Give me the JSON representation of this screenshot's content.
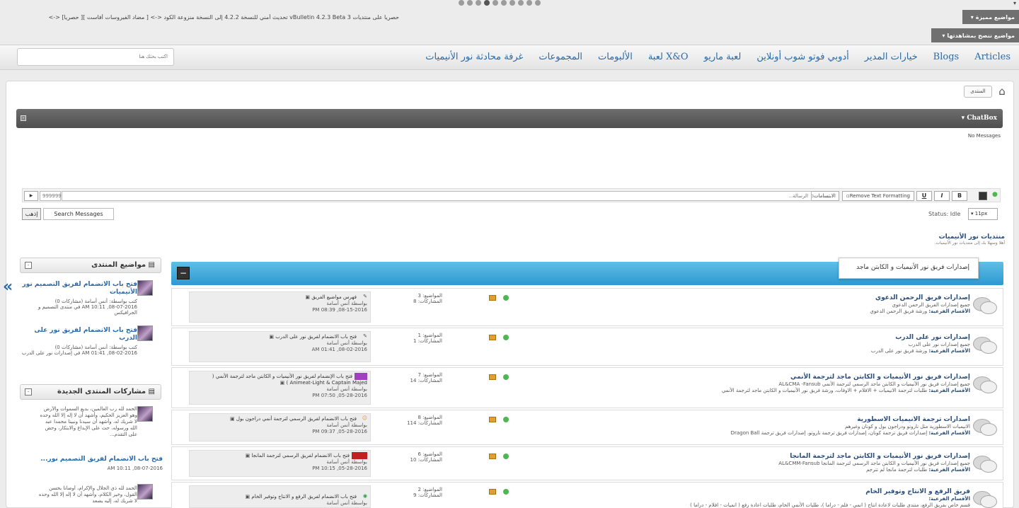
{
  "top": {
    "ticker": "<-> [حصرياً ][ مضاد الفيروسات أفاست ] <-> تحديث أمني للنسخة 4.2.2 إلى النسخة منزوعة الكود vBulletin 4.2.3 Beta 3 حصريا على منتديات",
    "featured_label": "مواضيع مميزة",
    "recommended_label": "مواضيع ننصح بمشاهدتها",
    "slider_dots": 10
  },
  "nav": {
    "items": [
      "Articles",
      "Blogs",
      "خيارات المدير",
      "أدوبي فوتو شوب أونلاين",
      "لعبة ماريو",
      "لعبة X&O",
      "الألبومات",
      "المجموعات",
      "غرفة محادثة نور الأنيميات"
    ],
    "search_placeholder": "اكتب بحثك هنا"
  },
  "breadcrumb": {
    "home": "المنتدى"
  },
  "chatbox": {
    "title": "ChatBox",
    "no_messages": "No Messages",
    "message_placeholder": "الرسالة...",
    "remove_formatting": "Remove Text Formatting",
    "smilies": "الابتسامات",
    "color_value": "999999",
    "status": "Status: Idle",
    "font_size": "11px",
    "search_messages": "Search Messages",
    "go": "إذهب",
    "btn_b": "B",
    "btn_i": "I",
    "btn_u": "U"
  },
  "forum": {
    "site_title": "منتديات نور الأنيميات",
    "site_welcome": "أهلا وسهلا بك إلى منتديات نور الأنيميات.",
    "category_tooltip": "إصدارات فريق نور الأنيميات و الكابتن ماجد",
    "rows": [
      {
        "title": "إصدارات فريق الرحمن الدعوي",
        "desc": "جميع إصدارات الفريق الرحمن الدعوي",
        "sub_label": "الأقسام الفرعية:",
        "subs": "ورشة فريق الرحمن الدعوي",
        "topics": "المواضيع: 3",
        "posts": "المشاركات: 8",
        "last_title": "فهرس مواضيع الفريق",
        "last_by": "بواسطة أنس أسامة",
        "last_date": "PM 08:39 ,08-15-2016"
      },
      {
        "title": "إصدارات نور على الدرب",
        "desc": "جميع إصدارات نور على الدرب",
        "sub_label": "الأقسام الفرعية:",
        "subs": "ورشة فريق نور على الدرب",
        "topics": "المواضيع: 1",
        "posts": "المشاركات: 1",
        "last_title": "فتح باب الانضمام لفريق نور على الدرب",
        "last_by": "بواسطة أنس أسامة",
        "last_date": "AM 01:41 ,08-02-2016"
      },
      {
        "title": "إصدارات فريق نور الأنيميات و الكابتن ماجد لترجمة الأنمي",
        "desc": "جميع إصدارات فريق نور الأنيميات و الكابتن ماجد الرسمي لترجمة الأنمي AL&CMA -Fansub",
        "sub_label": "الأقسام الفرعية:",
        "subs": "طلبات لترجمة الانيميات + الافلام + الاوفات، ورشة فريق نور الأنيميات و الكابتن ماجد لترجمة الأنمي",
        "topics": "المواضيع: 7",
        "posts": "المشاركات: 14",
        "last_title": "فتح باب الإنضمام لفريق نور الأنيميات و الكابتن ماجد لترجمة الأنمي ( Animeat-Light & Captain Majed )",
        "last_by": "بواسطة أنس أسامة",
        "last_date": "PM 07:50 ,05-28-2016"
      },
      {
        "title": "اصدارات ترجمة الانيميات الاسطورية",
        "desc": "الانيميات الاسطورية مثل ناروتو ودراجون بول و كونان وغيرهم",
        "sub_label": "الأقسام الفرعية:",
        "subs": "إصدارات فريق ترجمة كونان، إصدارات فريق ترجمة ناروتو، إصدارات فريق ترجمة Dragon Ball",
        "topics": "المواضيع: 8",
        "posts": "المشاركات: 114",
        "last_title": "فتح باب الانضمام لفريق الرسمي لترجمة أنمي دراجون بول",
        "last_by": "بواسطة أنس أسامة",
        "last_date": "PM 09:37 ,05-28-2016"
      },
      {
        "title": "إصدارات فريق نور الأنيميات و الكابتن ماجد لترجمة المانجا",
        "desc": "جميع إصدارات فريق نور الأنيميات و الكابتن ماجد الرسمي لترجمة المانجا AL&CMM-Fansub",
        "sub_label": "الأقسام الفرعية:",
        "subs": "طلبات لترجمة مانجا لم تترجم",
        "topics": "المواضيع: 6",
        "posts": "المشاركات: 10",
        "last_title": "فتح باب الانضمام لفريق الرسمي لترجمة المانجا",
        "last_by": "بواسطة أنس أسامة",
        "last_date": "PM 10:15 ,05-28-2016"
      },
      {
        "title": "فريق الرفع و الانتاج وتوفير الخام",
        "desc": "الأقسام الفرعية:",
        "sub_label": "",
        "subs": "قسم خاص بفريق الرفع، منتدى طلبات لاعادة انتاج ( انمي - فلم - دراما )، طلبات الأنمي الخام، طلبات اعادة رفع ( انميات - افلام - دراما )",
        "topics": "المواضيع: 2",
        "posts": "المشاركات: 9",
        "last_title": "فتح باب الانضمام لفريق الرفع و الانتاج وتوفير الخام",
        "last_by": "بواسطة أنس أسامة",
        "last_date": ""
      }
    ]
  },
  "sidebar": {
    "topics_title": "مواضيع المنتدى",
    "topics": [
      {
        "title": "فتح باب الانضمام لفريق التصميم نور الأنيميات",
        "meta": "كتب بواسطة: أنس أسامة (مشاركات 0)",
        "meta2": "AM 10:11 ,08-07-2016 في منتدى التصميم و الجرافيكس"
      },
      {
        "title": "فتح باب الانضمام لفريق نور على الدرب",
        "meta": "كتب بواسطة: أنس أسامة (مشاركات 0)",
        "meta2": "AM 01:41 ,08-02-2016 في إصدارات نور على الدرب"
      }
    ],
    "posts_title": "مشاركات المنتدى الجديدة",
    "post1_text": "الحمد لله رب العالمين، بديع السموات والأرض وهو العزيز الحكيم، وأشهد أن لا إله إلا الله وحده لا شريك له، وأشهد أن سيدنا ونبينا محمدا عبد الله ورسوله، حث على الإبداع والابتكار، وحض على التقدم...",
    "post1_link": "فتح باب الانضمام لفريق التصميم نور...",
    "post1_date": "AM 10:11 ,08-07-2016",
    "post2_text": "الحمد لله ذي الجلال والإكرام، أوصانا بحسن القول، وخير الكلام، وأشهد أن لا إله إلا الله وحده لا شريك له، إليه يصعد"
  }
}
